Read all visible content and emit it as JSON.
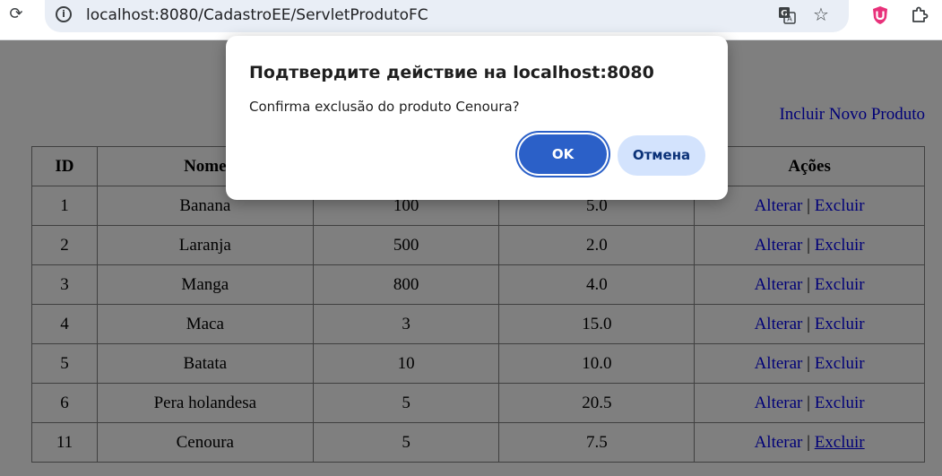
{
  "browser": {
    "url": "localhost:8080/CadastroEE/ServletProdutoFC",
    "reload_glyph": "⟳",
    "info_glyph": "i",
    "star_glyph": "☆",
    "icons": [
      "reload-icon",
      "site-info-icon",
      "translate-icon",
      "bookmark-star-icon",
      "extension-u-icon",
      "extensions-puzzle-icon"
    ]
  },
  "page": {
    "new_product_link": "Incluir Novo Produto",
    "table": {
      "headers": [
        "ID",
        "Nome",
        "",
        "",
        "Ações"
      ],
      "action_alter": "Alterar",
      "action_separator": "|",
      "action_delete": "Excluir",
      "rows": [
        {
          "id": "1",
          "nome": "Banana",
          "quantidade": "100",
          "preco": "5.0"
        },
        {
          "id": "2",
          "nome": "Laranja",
          "quantidade": "500",
          "preco": "2.0"
        },
        {
          "id": "3",
          "nome": "Manga",
          "quantidade": "800",
          "preco": "4.0"
        },
        {
          "id": "4",
          "nome": "Maca",
          "quantidade": "3",
          "preco": "15.0"
        },
        {
          "id": "5",
          "nome": "Batata",
          "quantidade": "10",
          "preco": "10.0"
        },
        {
          "id": "6",
          "nome": "Pera holandesa",
          "quantidade": "5",
          "preco": "20.5"
        },
        {
          "id": "11",
          "nome": "Cenoura",
          "quantidade": "5",
          "preco": "7.5"
        }
      ]
    }
  },
  "dialog": {
    "title": "Подтвердите действие на localhost:8080",
    "message": "Confirma exclusão do produto Cenoura?",
    "ok_label": "OK",
    "cancel_label": "Отмена"
  },
  "colors": {
    "link": "#0000ee",
    "ok_button": "#2b60c8",
    "cancel_button": "#d3e3fd",
    "omnibox": "#e9eef6"
  }
}
